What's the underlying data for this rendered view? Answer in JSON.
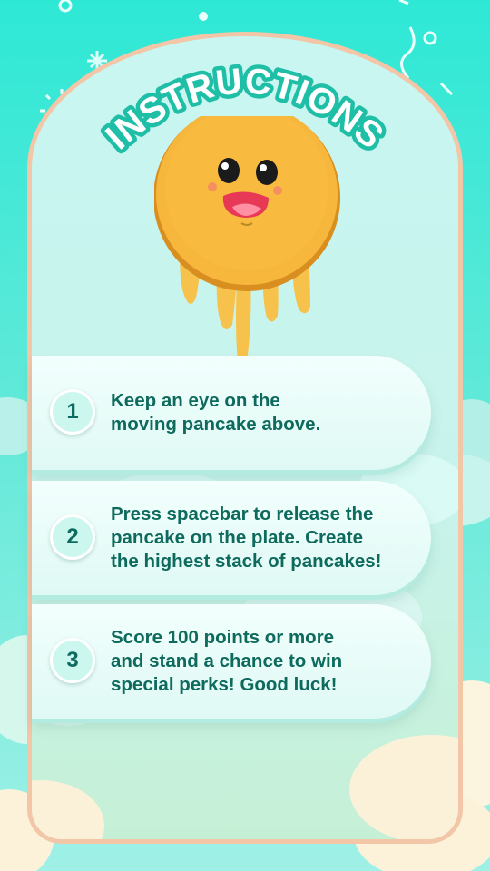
{
  "title": "INSTRUCTIONS",
  "colors": {
    "background": "#3fe3d2",
    "card_border": "#f3c6a8",
    "text": "#0d6a5d",
    "pancake": "#f6b73c"
  },
  "mascot": {
    "icon": "pancake-face-icon"
  },
  "steps": [
    {
      "number": "1",
      "lines": [
        "Keep an eye on the",
        "moving pancake above."
      ]
    },
    {
      "number": "2",
      "lines": [
        "Press spacebar to release the",
        "pancake on the plate. Create",
        "the highest stack of pancakes!"
      ]
    },
    {
      "number": "3",
      "lines": [
        "Score 100 points or more",
        "and stand a chance to win",
        "special perks! Good luck!"
      ]
    }
  ]
}
